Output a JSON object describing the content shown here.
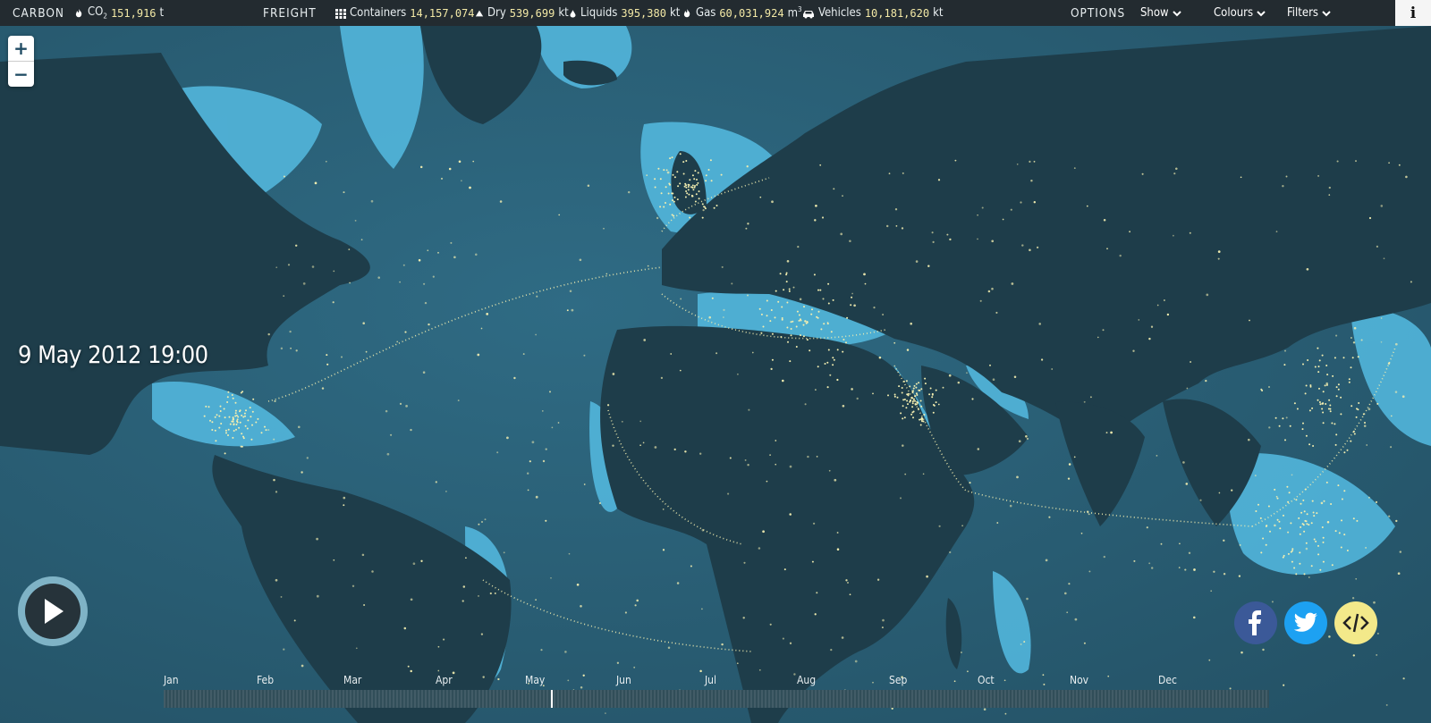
{
  "topbar": {
    "carbon": {
      "title": "CARBON",
      "co2_label": "CO",
      "co2_sub": "2",
      "co2_value": "151,916",
      "co2_unit": "t"
    },
    "freight": {
      "title": "FREIGHT",
      "containers": {
        "label": "Containers",
        "value": "14,157,074",
        "icon": "grid-icon"
      },
      "dry": {
        "label": "Dry",
        "value": "539,699",
        "unit": "kt",
        "icon": "triangle-icon"
      },
      "liquids": {
        "label": "Liquids",
        "value": "395,380",
        "unit": "kt",
        "icon": "drop-icon"
      },
      "gas": {
        "label": "Gas",
        "value": "60,031,924",
        "unit": "m",
        "unit_sup": "3",
        "icon": "flame-icon"
      },
      "vehicles": {
        "label": "Vehicles",
        "value": "10,181,620",
        "unit": "kt",
        "icon": "car-icon"
      }
    },
    "options": {
      "title": "OPTIONS",
      "menus": [
        "Show",
        "Colours",
        "Filters"
      ]
    },
    "info_label": "i"
  },
  "map": {
    "zoom_in": "+",
    "zoom_out": "−",
    "date_label": "9 May 2012 19:00"
  },
  "timeline": {
    "months": [
      "Jan",
      "Feb",
      "Mar",
      "Apr",
      "May",
      "Jun",
      "Jul",
      "Aug",
      "Sep",
      "Oct",
      "Nov",
      "Dec"
    ],
    "position_fraction": 0.35
  },
  "colors": {
    "ocean_deep": "#27566b",
    "shelf": "#4fb4d9",
    "land": "#1f3a47",
    "ship": "#f3eeb0",
    "value_text": "#f3e9a6"
  }
}
